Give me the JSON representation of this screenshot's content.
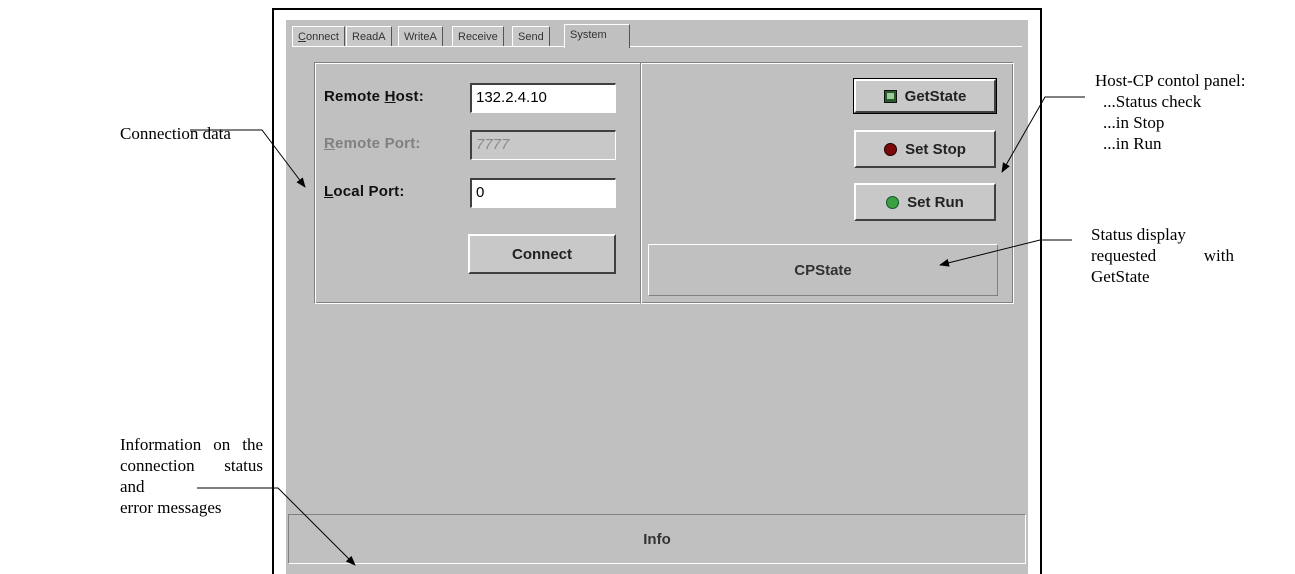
{
  "annotations": {
    "connection_data": "Connection data",
    "control_panel": [
      "Host-CP contol panel:",
      "...Status check",
      "...in Stop",
      "...in Run"
    ],
    "status_display": [
      "Status display",
      "requested with",
      "GetState"
    ],
    "info_label": [
      "Information on the",
      "connection status and",
      "error messages"
    ]
  },
  "tabs": [
    "Connect",
    "ReadA",
    "WriteA",
    "Receive",
    "Send",
    "System"
  ],
  "active_tab": "System",
  "connection": {
    "remote_host_label_pre": "Remote ",
    "remote_host_label_key": "H",
    "remote_host_label_post": "ost:",
    "remote_host_value": "132.2.4.10",
    "remote_port_label_key": "R",
    "remote_port_label_post": "emote Port:",
    "remote_port_value": "7777",
    "local_port_label_key": "L",
    "local_port_label_post": "ocal Port:",
    "local_port_value": "0",
    "connect_button": "Connect"
  },
  "control": {
    "get_state_button": "GetState",
    "set_stop_button": "Set Stop",
    "set_run_button": "Set Run",
    "cp_state_display": "CPState"
  },
  "info_panel": "Info",
  "colors": {
    "stop_led": "#7a0a0a",
    "run_led": "#3aa040",
    "window_bg": "#c0c0c0"
  }
}
